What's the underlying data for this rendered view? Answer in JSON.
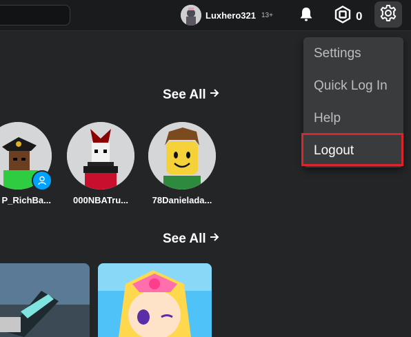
{
  "header": {
    "username": "Luxhero321",
    "age_badge": "13+",
    "robux_count": "0"
  },
  "sections": {
    "friends_see_all": "See All",
    "games_see_all": "See All"
  },
  "friends": [
    {
      "name": "P_RichBa..."
    },
    {
      "name": "000NBATru..."
    },
    {
      "name": "78Danielada..."
    }
  ],
  "settings_menu": {
    "items": [
      {
        "label": "Settings"
      },
      {
        "label": "Quick Log In"
      },
      {
        "label": "Help"
      },
      {
        "label": "Logout"
      }
    ]
  },
  "colors": {
    "background": "#232527",
    "topbar": "#191b1d",
    "menu": "#393b3d",
    "highlight": "#d7262c",
    "presence": "#00a2ff"
  }
}
